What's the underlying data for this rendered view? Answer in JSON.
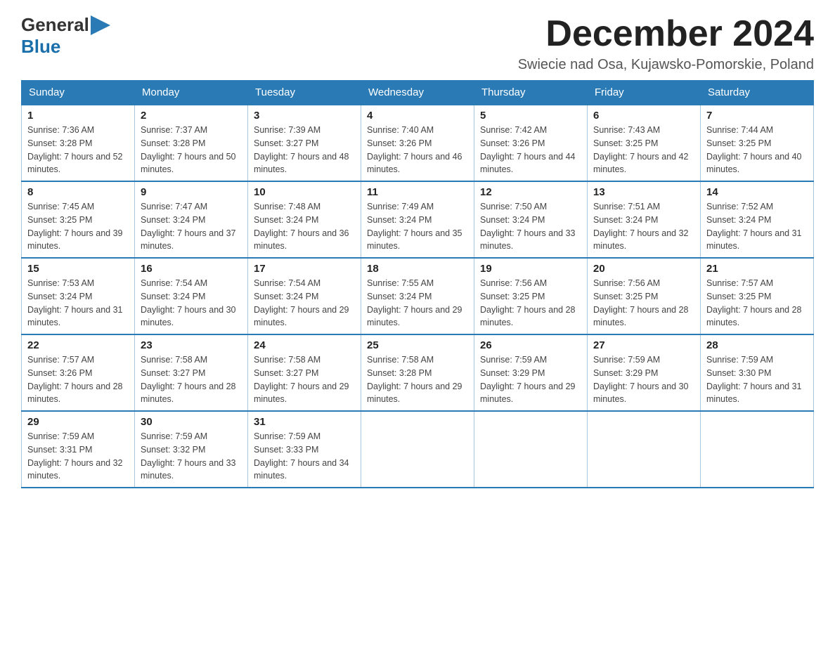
{
  "header": {
    "logo_general": "General",
    "logo_blue": "Blue",
    "month_title": "December 2024",
    "subtitle": "Swiecie nad Osa, Kujawsko-Pomorskie, Poland"
  },
  "days_of_week": [
    "Sunday",
    "Monday",
    "Tuesday",
    "Wednesday",
    "Thursday",
    "Friday",
    "Saturday"
  ],
  "weeks": [
    [
      {
        "day": "1",
        "sunrise": "7:36 AM",
        "sunset": "3:28 PM",
        "daylight": "7 hours and 52 minutes."
      },
      {
        "day": "2",
        "sunrise": "7:37 AM",
        "sunset": "3:28 PM",
        "daylight": "7 hours and 50 minutes."
      },
      {
        "day": "3",
        "sunrise": "7:39 AM",
        "sunset": "3:27 PM",
        "daylight": "7 hours and 48 minutes."
      },
      {
        "day": "4",
        "sunrise": "7:40 AM",
        "sunset": "3:26 PM",
        "daylight": "7 hours and 46 minutes."
      },
      {
        "day": "5",
        "sunrise": "7:42 AM",
        "sunset": "3:26 PM",
        "daylight": "7 hours and 44 minutes."
      },
      {
        "day": "6",
        "sunrise": "7:43 AM",
        "sunset": "3:25 PM",
        "daylight": "7 hours and 42 minutes."
      },
      {
        "day": "7",
        "sunrise": "7:44 AM",
        "sunset": "3:25 PM",
        "daylight": "7 hours and 40 minutes."
      }
    ],
    [
      {
        "day": "8",
        "sunrise": "7:45 AM",
        "sunset": "3:25 PM",
        "daylight": "7 hours and 39 minutes."
      },
      {
        "day": "9",
        "sunrise": "7:47 AM",
        "sunset": "3:24 PM",
        "daylight": "7 hours and 37 minutes."
      },
      {
        "day": "10",
        "sunrise": "7:48 AM",
        "sunset": "3:24 PM",
        "daylight": "7 hours and 36 minutes."
      },
      {
        "day": "11",
        "sunrise": "7:49 AM",
        "sunset": "3:24 PM",
        "daylight": "7 hours and 35 minutes."
      },
      {
        "day": "12",
        "sunrise": "7:50 AM",
        "sunset": "3:24 PM",
        "daylight": "7 hours and 33 minutes."
      },
      {
        "day": "13",
        "sunrise": "7:51 AM",
        "sunset": "3:24 PM",
        "daylight": "7 hours and 32 minutes."
      },
      {
        "day": "14",
        "sunrise": "7:52 AM",
        "sunset": "3:24 PM",
        "daylight": "7 hours and 31 minutes."
      }
    ],
    [
      {
        "day": "15",
        "sunrise": "7:53 AM",
        "sunset": "3:24 PM",
        "daylight": "7 hours and 31 minutes."
      },
      {
        "day": "16",
        "sunrise": "7:54 AM",
        "sunset": "3:24 PM",
        "daylight": "7 hours and 30 minutes."
      },
      {
        "day": "17",
        "sunrise": "7:54 AM",
        "sunset": "3:24 PM",
        "daylight": "7 hours and 29 minutes."
      },
      {
        "day": "18",
        "sunrise": "7:55 AM",
        "sunset": "3:24 PM",
        "daylight": "7 hours and 29 minutes."
      },
      {
        "day": "19",
        "sunrise": "7:56 AM",
        "sunset": "3:25 PM",
        "daylight": "7 hours and 28 minutes."
      },
      {
        "day": "20",
        "sunrise": "7:56 AM",
        "sunset": "3:25 PM",
        "daylight": "7 hours and 28 minutes."
      },
      {
        "day": "21",
        "sunrise": "7:57 AM",
        "sunset": "3:25 PM",
        "daylight": "7 hours and 28 minutes."
      }
    ],
    [
      {
        "day": "22",
        "sunrise": "7:57 AM",
        "sunset": "3:26 PM",
        "daylight": "7 hours and 28 minutes."
      },
      {
        "day": "23",
        "sunrise": "7:58 AM",
        "sunset": "3:27 PM",
        "daylight": "7 hours and 28 minutes."
      },
      {
        "day": "24",
        "sunrise": "7:58 AM",
        "sunset": "3:27 PM",
        "daylight": "7 hours and 29 minutes."
      },
      {
        "day": "25",
        "sunrise": "7:58 AM",
        "sunset": "3:28 PM",
        "daylight": "7 hours and 29 minutes."
      },
      {
        "day": "26",
        "sunrise": "7:59 AM",
        "sunset": "3:29 PM",
        "daylight": "7 hours and 29 minutes."
      },
      {
        "day": "27",
        "sunrise": "7:59 AM",
        "sunset": "3:29 PM",
        "daylight": "7 hours and 30 minutes."
      },
      {
        "day": "28",
        "sunrise": "7:59 AM",
        "sunset": "3:30 PM",
        "daylight": "7 hours and 31 minutes."
      }
    ],
    [
      {
        "day": "29",
        "sunrise": "7:59 AM",
        "sunset": "3:31 PM",
        "daylight": "7 hours and 32 minutes."
      },
      {
        "day": "30",
        "sunrise": "7:59 AM",
        "sunset": "3:32 PM",
        "daylight": "7 hours and 33 minutes."
      },
      {
        "day": "31",
        "sunrise": "7:59 AM",
        "sunset": "3:33 PM",
        "daylight": "7 hours and 34 minutes."
      },
      null,
      null,
      null,
      null
    ]
  ],
  "labels": {
    "sunrise": "Sunrise:",
    "sunset": "Sunset:",
    "daylight": "Daylight:"
  }
}
